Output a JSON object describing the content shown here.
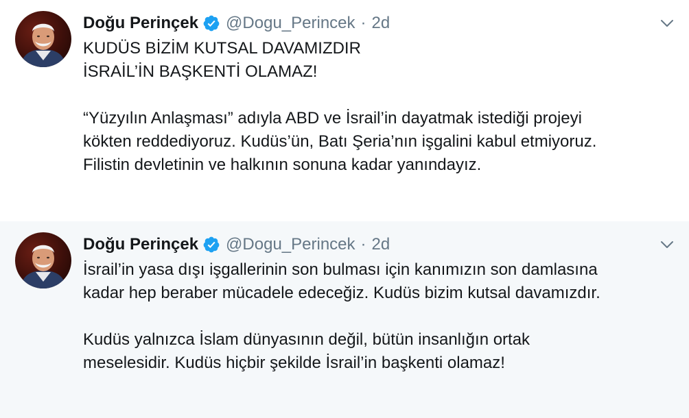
{
  "tweets": [
    {
      "author": {
        "name": "Doğu Perinçek",
        "handle": "@Dogu_Perincek"
      },
      "separator": "·",
      "time": "2d",
      "paragraphs": [
        [
          "KUDÜS BİZİM KUTSAL DAVAMIZDIR",
          "İSRAİL’İN BAŞKENTİ OLAMAZ!"
        ],
        [
          "“Yüzyılın Anlaşması” adıyla ABD ve İsrail’in dayatmak istediği projeyi",
          "kökten reddediyoruz. Kudüs’ün, Batı Şeria’nın işgalini kabul etmiyoruz.",
          "Filistin devletinin ve halkının sonuna kadar yanındayız."
        ]
      ]
    },
    {
      "author": {
        "name": "Doğu Perinçek",
        "handle": "@Dogu_Perincek"
      },
      "separator": "·",
      "time": "2d",
      "paragraphs": [
        [
          "İsrail’in yasa dışı işgallerinin son bulması için kanımızın son damlasına",
          "kadar hep beraber mücadele edeceğiz. Kudüs bizim kutsal davamızdır."
        ],
        [
          "Kudüs yalnızca İslam dünyasının değil, bütün insanlığın ortak",
          "meselesidir. Kudüs hiçbir şekilde İsrail’in başkenti olamaz!"
        ]
      ]
    }
  ],
  "colors": {
    "verified": "#1da1f2",
    "secondary_text": "#657786",
    "primary_text": "#14171a",
    "highlight_bg": "#f5f8fa"
  }
}
